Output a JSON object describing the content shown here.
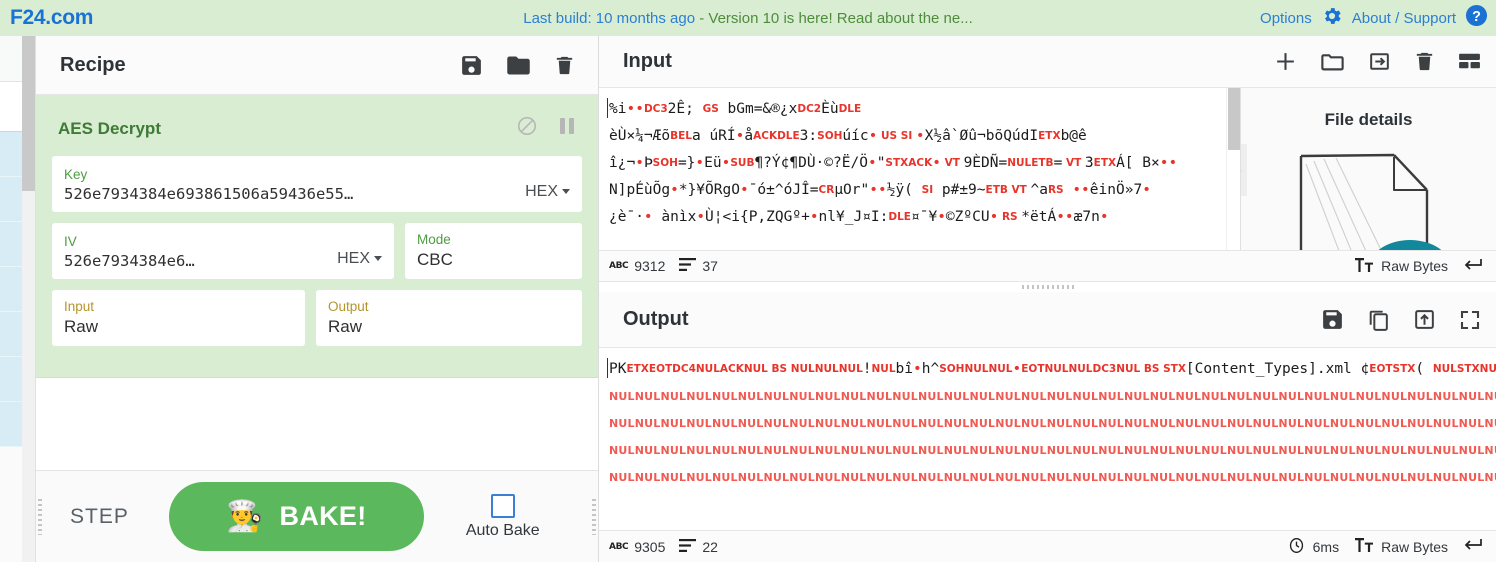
{
  "banner": {
    "brand": "F24.com",
    "message_primary": "Last build: 10 months ago",
    "message_separator": " - ",
    "message_secondary": "Version 10 is here! Read about the ne...",
    "options_label": "Options",
    "about_label": "About / Support",
    "gear_icon": "gear-icon",
    "help_icon": "question-circle-icon",
    "background": "#d9edd3",
    "link_color": "#2b7fd4"
  },
  "recipe": {
    "title": "Recipe",
    "icons": [
      {
        "name": "save-recipe-icon",
        "glyph": "floppy"
      },
      {
        "name": "load-recipe-icon",
        "glyph": "folder"
      },
      {
        "name": "clear-recipe-icon",
        "glyph": "trash"
      }
    ],
    "operation": {
      "name": "AES Decrypt",
      "accent_color": "#3f7a36",
      "background": "#d9edd3",
      "disable_icon": "disable-icon",
      "breakpoint_icon": "pause-icon",
      "args": [
        {
          "label": "Key",
          "value": "526e7934384e693861506a59436e55…",
          "option": "HEX",
          "type": "text-with-select"
        },
        {
          "label": "IV",
          "value": "526e7934384e6…",
          "option": "HEX",
          "type": "text-with-select"
        },
        {
          "label": "Mode",
          "value": "CBC",
          "type": "select"
        },
        {
          "label": "Input",
          "value": "Raw",
          "type": "select"
        },
        {
          "label": "Output",
          "value": "Raw",
          "type": "select"
        }
      ]
    },
    "controls": {
      "step_label": "STEP",
      "bake_label": "BAKE!",
      "bake_icon": "chef-icon",
      "bake_color": "#5cb85c",
      "auto_bake_label": "Auto Bake",
      "auto_bake_checked": false
    }
  },
  "input": {
    "title": "Input",
    "icons": [
      {
        "name": "add-input-tab-icon",
        "glyph": "plus"
      },
      {
        "name": "open-folder-icon",
        "glyph": "folder"
      },
      {
        "name": "open-input-icon",
        "glyph": "arrow-into-box"
      },
      {
        "name": "clear-input-icon",
        "glyph": "trash"
      },
      {
        "name": "input-layout-icon",
        "glyph": "panels"
      }
    ],
    "lines": [
      [
        {
          "t": "%i",
          "k": "p"
        },
        {
          "t": "••",
          "k": "d"
        },
        {
          "t": "DC3",
          "k": "c"
        },
        {
          "t": "2Ê; ",
          "k": "p"
        },
        {
          "t": "GS",
          "k": "c"
        },
        {
          "t": " bGm=&®¿x",
          "k": "p"
        },
        {
          "t": "DC2",
          "k": "c"
        },
        {
          "t": "Èù",
          "k": "p"
        },
        {
          "t": "DLE",
          "k": "c"
        }
      ],
      [
        {
          "t": "èÙ×¼¬Æõ",
          "k": "p"
        },
        {
          "t": "BEL",
          "k": "c"
        },
        {
          "t": "a  úRÍ",
          "k": "p"
        },
        {
          "t": "•",
          "k": "d"
        },
        {
          "t": "å",
          "k": "p"
        },
        {
          "t": "ACKDLE",
          "k": "c"
        },
        {
          "t": "3:",
          "k": "p"
        },
        {
          "t": "SOH",
          "k": "c"
        },
        {
          "t": "úíc",
          "k": "p"
        },
        {
          "t": "•",
          "k": "d"
        },
        {
          "t": " US SI ",
          "k": "c"
        },
        {
          "t": "•",
          "k": "d"
        },
        {
          "t": "X½â`Øû¬bõQúdI",
          "k": "p"
        },
        {
          "t": "ETX",
          "k": "c"
        },
        {
          "t": "b@ê",
          "k": "p"
        }
      ],
      [
        {
          "t": "î¿¬",
          "k": "p"
        },
        {
          "t": "•",
          "k": "d"
        },
        {
          "t": "Þ",
          "k": "p"
        },
        {
          "t": "SOH",
          "k": "c"
        },
        {
          "t": "=}",
          "k": "p"
        },
        {
          "t": "•",
          "k": "d"
        },
        {
          "t": "Eü",
          "k": "p"
        },
        {
          "t": "•",
          "k": "d"
        },
        {
          "t": "SUB",
          "k": "c"
        },
        {
          "t": "¶?Ý¢¶DÙ·©?Ë/Ö",
          "k": "p"
        },
        {
          "t": "•",
          "k": "d"
        },
        {
          "t": "\"",
          "k": "p"
        },
        {
          "t": "STXACK",
          "k": "c"
        },
        {
          "t": "•",
          "k": "d"
        },
        {
          "t": " VT ",
          "k": "c"
        },
        {
          "t": "9ÈDÑ=",
          "k": "p"
        },
        {
          "t": "NULETB",
          "k": "c"
        },
        {
          "t": "=",
          "k": "p"
        },
        {
          "t": " VT ",
          "k": "c"
        },
        {
          "t": "3",
          "k": "p"
        },
        {
          "t": "ETX",
          "k": "c"
        },
        {
          "t": "Á[ B×",
          "k": "p"
        },
        {
          "t": "••",
          "k": "d"
        }
      ],
      [
        {
          "t": "N]pÉùÕg",
          "k": "p"
        },
        {
          "t": "•",
          "k": "d"
        },
        {
          "t": "*}¥ÕRgO",
          "k": "p"
        },
        {
          "t": "•",
          "k": "d"
        },
        {
          "t": "¯ó±^óJÎ=",
          "k": "p"
        },
        {
          "t": "CR",
          "k": "c"
        },
        {
          "t": "µOr\"",
          "k": "p"
        },
        {
          "t": "••",
          "k": "d"
        },
        {
          "t": "½ÿ( ",
          "k": "p"
        },
        {
          "t": "SI",
          "k": "c"
        },
        {
          "t": " p#±9~",
          "k": "p"
        },
        {
          "t": "ETB",
          "k": "c"
        },
        {
          "t": " VT ",
          "k": "c"
        },
        {
          "t": "^a",
          "k": "p"
        },
        {
          "t": "RS",
          "k": "c"
        },
        {
          "t": " ",
          "k": "p"
        },
        {
          "t": "••",
          "k": "d"
        },
        {
          "t": "êinÖ»7",
          "k": "p"
        },
        {
          "t": "•",
          "k": "d"
        }
      ],
      [
        {
          "t": "¿è¯·",
          "k": "p"
        },
        {
          "t": "•",
          "k": "d"
        },
        {
          "t": "    ànìx",
          "k": "p"
        },
        {
          "t": "•",
          "k": "d"
        },
        {
          "t": "Ù¦<i{P,ZQGº+",
          "k": "p"
        },
        {
          "t": "•",
          "k": "d"
        },
        {
          "t": "nl¥_J¤I:",
          "k": "p"
        },
        {
          "t": "DLE",
          "k": "c"
        },
        {
          "t": "¤¯¥",
          "k": "p"
        },
        {
          "t": "•",
          "k": "d"
        },
        {
          "t": "©ZºCU",
          "k": "p"
        },
        {
          "t": "•",
          "k": "d"
        },
        {
          "t": " RS ",
          "k": "c"
        },
        {
          "t": "*ëtÁ",
          "k": "p"
        },
        {
          "t": "••",
          "k": "d"
        },
        {
          "t": "æ7n",
          "k": "p"
        },
        {
          "t": "•",
          "k": "d"
        }
      ]
    ],
    "status": {
      "length_icon": "abc-icon",
      "length": "9312",
      "lines_icon": "lines-icon",
      "lines": "37",
      "charset_icon": "font-size-icon",
      "charset": "Raw Bytes",
      "eol_icon": "line-ending-icon"
    }
  },
  "file_details": {
    "title": "File details",
    "thumbnail_icon": "document-sketch-icon",
    "collapse_icon": "chevron-right-icon"
  },
  "output": {
    "title": "Output",
    "icons": [
      {
        "name": "save-output-icon",
        "glyph": "floppy"
      },
      {
        "name": "copy-output-icon",
        "glyph": "copy"
      },
      {
        "name": "replace-input-icon",
        "glyph": "export"
      },
      {
        "name": "maximise-output-icon",
        "glyph": "expand"
      }
    ],
    "first_line": [
      {
        "t": "PK",
        "k": "p"
      },
      {
        "t": "ETXEOTDC4NULACKNUL BS NULNULNUL",
        "k": "c"
      },
      {
        "t": "!",
        "k": "p"
      },
      {
        "t": "NUL",
        "k": "c"
      },
      {
        "t": "bî",
        "k": "p"
      },
      {
        "t": "•",
        "k": "d"
      },
      {
        "t": "h^",
        "k": "p"
      },
      {
        "t": "SOHNULNUL",
        "k": "c"
      },
      {
        "t": "•",
        "k": "d"
      },
      {
        "t": "EOTNULNULDC3NUL BS STX",
        "k": "c"
      },
      {
        "t": "[Content_Types].xml",
        "k": "p"
      },
      {
        "t": " ¢",
        "k": "p"
      },
      {
        "t": "EOTSTX",
        "k": "c"
      },
      {
        "t": "( ",
        "k": "p"
      },
      {
        "t": "NULSTXNULNULNULNUL",
        "k": "c"
      }
    ],
    "nul_lines": 4,
    "nul_text": "NUL",
    "nul_repeat": 58,
    "status": {
      "length_icon": "abc-icon",
      "length": "9305",
      "lines_icon": "lines-icon",
      "lines": "22",
      "timing_icon": "clock-icon",
      "timing": "6ms",
      "charset_icon": "font-size-icon",
      "charset": "Raw Bytes",
      "eol_icon": "line-ending-icon"
    }
  },
  "operations_sliver": {
    "visible_item_count": 7
  }
}
